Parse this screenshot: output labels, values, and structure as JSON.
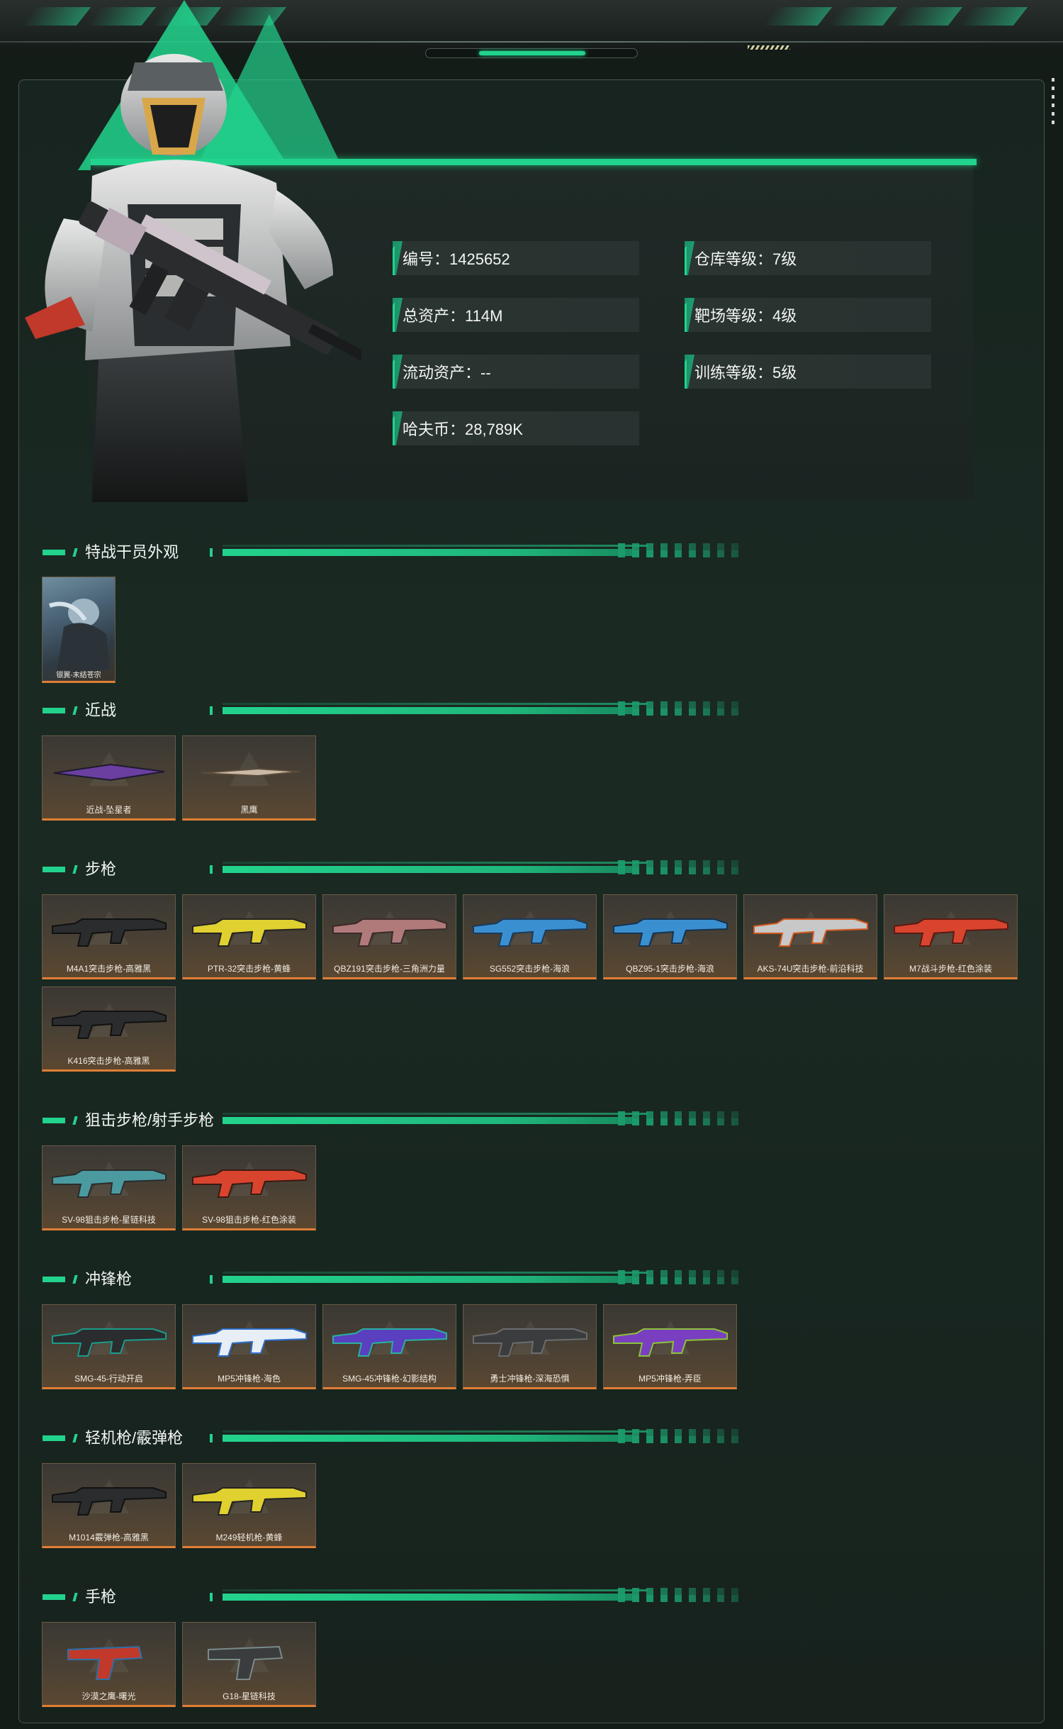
{
  "profile": {
    "stats_left": [
      {
        "label": "编号",
        "value": "1425652"
      },
      {
        "label": "总资产",
        "value": "114M"
      },
      {
        "label": "流动资产",
        "value": "--"
      },
      {
        "label": "哈夫币",
        "value": "28,789K"
      }
    ],
    "stats_right": [
      {
        "label": "仓库等级",
        "value": "7级"
      },
      {
        "label": "靶场等级",
        "value": "4级"
      },
      {
        "label": "训练等级",
        "value": "5级"
      }
    ],
    "text": {
      "id": "编号：1425652",
      "assets": "总资产：114M",
      "liquid": "流动资产：--",
      "coin": "哈夫币：28,789K",
      "warehouse": "仓库等级：7级",
      "range": "靶场等级：4级",
      "training": "训练等级：5级"
    }
  },
  "sections": [
    {
      "title": "特战干员外观",
      "items": [
        "银翼-末结苍宗"
      ]
    },
    {
      "title": "近战",
      "items": [
        "近战-坠星者",
        "黑鹰"
      ]
    },
    {
      "title": "步枪",
      "items": [
        "M4A1突击步枪-高雅黑",
        "PTR-32突击步枪-黄蜂",
        "QBZ191突击步枪-三角洲力量",
        "SG552突击步枪-海浪",
        "QBZ95-1突击步枪-海浪",
        "AKS-74U突击步枪-前沿科技",
        "M7战斗步枪-红色涂装",
        "K416突击步枪-高雅黑"
      ]
    },
    {
      "title": "狙击步枪/射手步枪",
      "items": [
        "SV-98狙击步枪-星链科技",
        "SV-98狙击步枪-红色涂装"
      ]
    },
    {
      "title": "冲锋枪",
      "items": [
        "SMG-45-行动开启",
        "MP5冲锋枪-海色",
        "SMG-45冲锋枪-幻影结构",
        "勇士冲锋枪-深海恐惧",
        "MP5冲锋枪-弄臣"
      ]
    },
    {
      "title": "轻机枪/霰弹枪",
      "items": [
        "M1014霰弹枪-高雅黑",
        "M249轻机枪-黄蜂"
      ]
    },
    {
      "title": "手枪",
      "items": [
        "沙漠之鹰-曙光",
        "G18-星链科技"
      ]
    }
  ],
  "colors": {
    "accent": "#22d38d",
    "card_border": "#e07e35",
    "background": "#141c18"
  },
  "icons": [
    "operator-portrait",
    "triangle-logo",
    "gun-thumbnail"
  ]
}
